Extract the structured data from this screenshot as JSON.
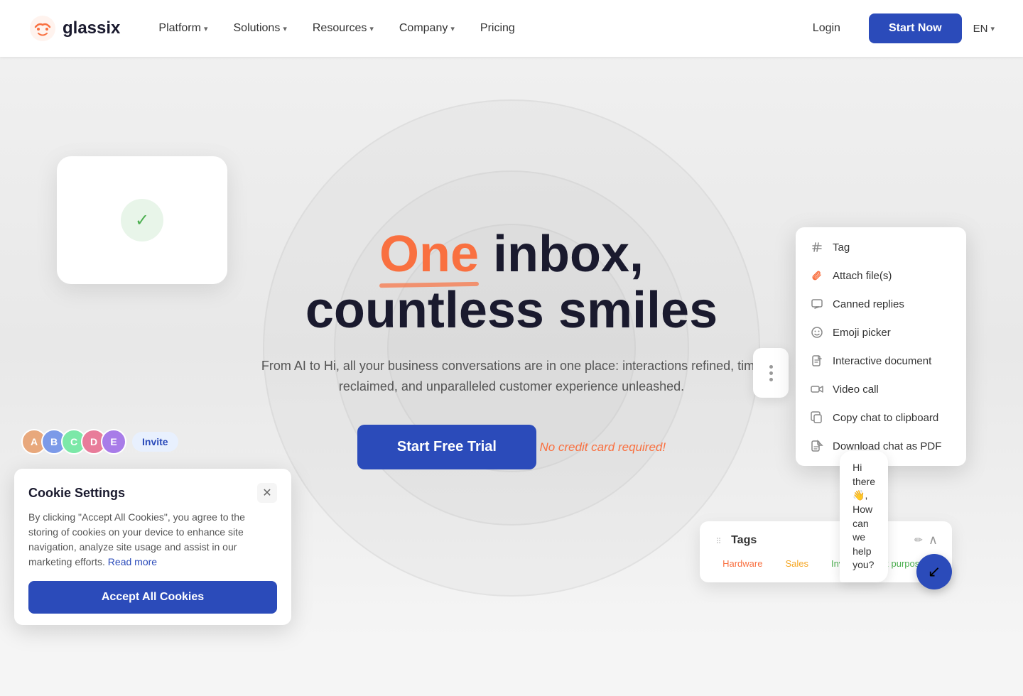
{
  "navbar": {
    "logo_text": "glassix",
    "nav_items": [
      {
        "label": "Platform",
        "has_dropdown": true
      },
      {
        "label": "Solutions",
        "has_dropdown": true
      },
      {
        "label": "Resources",
        "has_dropdown": true
      },
      {
        "label": "Company",
        "has_dropdown": true
      },
      {
        "label": "Pricing",
        "has_dropdown": false
      }
    ],
    "login_label": "Login",
    "start_now_label": "Start Now",
    "lang": "EN"
  },
  "hero": {
    "title_highlight": "One",
    "title_rest": " inbox,",
    "title_line2": "countless smiles",
    "subtitle": "From AI to Hi, all your business conversations are in one place: interactions refined, time reclaimed, and unparalleled customer experience unleashed.",
    "cta_label": "Start Free Trial",
    "no_cc": "No credit card required!"
  },
  "context_menu": {
    "items": [
      {
        "icon": "hash",
        "label": "Tag"
      },
      {
        "icon": "paperclip",
        "label": "Attach file(s)"
      },
      {
        "icon": "reply",
        "label": "Canned replies"
      },
      {
        "icon": "emoji",
        "label": "Emoji picker"
      },
      {
        "icon": "document",
        "label": "Interactive document"
      },
      {
        "icon": "video",
        "label": "Video call"
      },
      {
        "icon": "copy",
        "label": "Copy chat to clipboard"
      },
      {
        "icon": "pdf",
        "label": "Download chat as PDF"
      }
    ]
  },
  "tags_card": {
    "title": "Tags",
    "tags": [
      {
        "label": "Hardware",
        "color": "hardware"
      },
      {
        "label": "Sales",
        "color": "sales"
      },
      {
        "label": "Invoice for tax purposes",
        "color": "invoice"
      }
    ]
  },
  "chat_bubble": {
    "line1": "Hi there 👋,",
    "line2": "How can we help you?"
  },
  "invite": {
    "button_label": "Invite"
  },
  "cookie": {
    "title": "Cookie Settings",
    "body": "By clicking \"Accept All Cookies\", you agree to the storing of cookies on your device to enhance site navigation, analyze site usage and assist in our marketing efforts.",
    "read_more": "Read more",
    "accept_label": "Accept All Cookies"
  }
}
